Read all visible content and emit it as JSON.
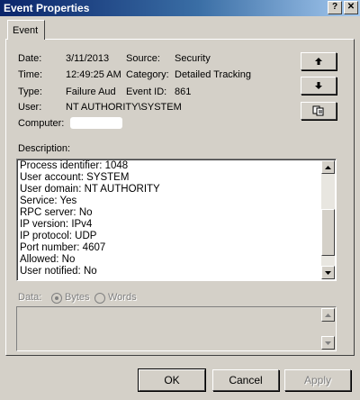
{
  "window": {
    "title": "Event Properties",
    "help_glyph": "?",
    "close_glyph": "✕"
  },
  "tabs": [
    {
      "label": "Event"
    }
  ],
  "fields": {
    "date_label": "Date:",
    "date_value": "3/11/2013",
    "source_label": "Source:",
    "source_value": "Security",
    "time_label": "Time:",
    "time_value": "12:49:25 AM",
    "category_label": "Category:",
    "category_value": "Detailed Tracking",
    "type_label": "Type:",
    "type_value": "Failure Aud",
    "eventid_label": "Event ID:",
    "eventid_value": "861",
    "user_label": "User:",
    "user_value": "NT AUTHORITY\\SYSTEM",
    "computer_label": "Computer:"
  },
  "side_buttons": {
    "up_icon": "arrow-up-icon",
    "down_icon": "arrow-down-icon",
    "copy_icon": "copy-icon"
  },
  "description": {
    "label": "Description:",
    "lines": [
      "Process identifier: 1048",
      "User account: SYSTEM",
      "User domain: NT AUTHORITY",
      "Service: Yes",
      "RPC server: No",
      "IP version: IPv4",
      "IP protocol: UDP",
      "Port number: 4607",
      "Allowed: No",
      "User notified: No"
    ]
  },
  "data_section": {
    "label": "Data:",
    "bytes_label": "Bytes",
    "words_label": "Words",
    "selected": "Bytes"
  },
  "buttons": {
    "ok": "OK",
    "cancel": "Cancel",
    "apply": "Apply"
  },
  "colors": {
    "titlebar_start": "#0a246a",
    "titlebar_end": "#a6caf0",
    "face": "#d4d0c8"
  }
}
